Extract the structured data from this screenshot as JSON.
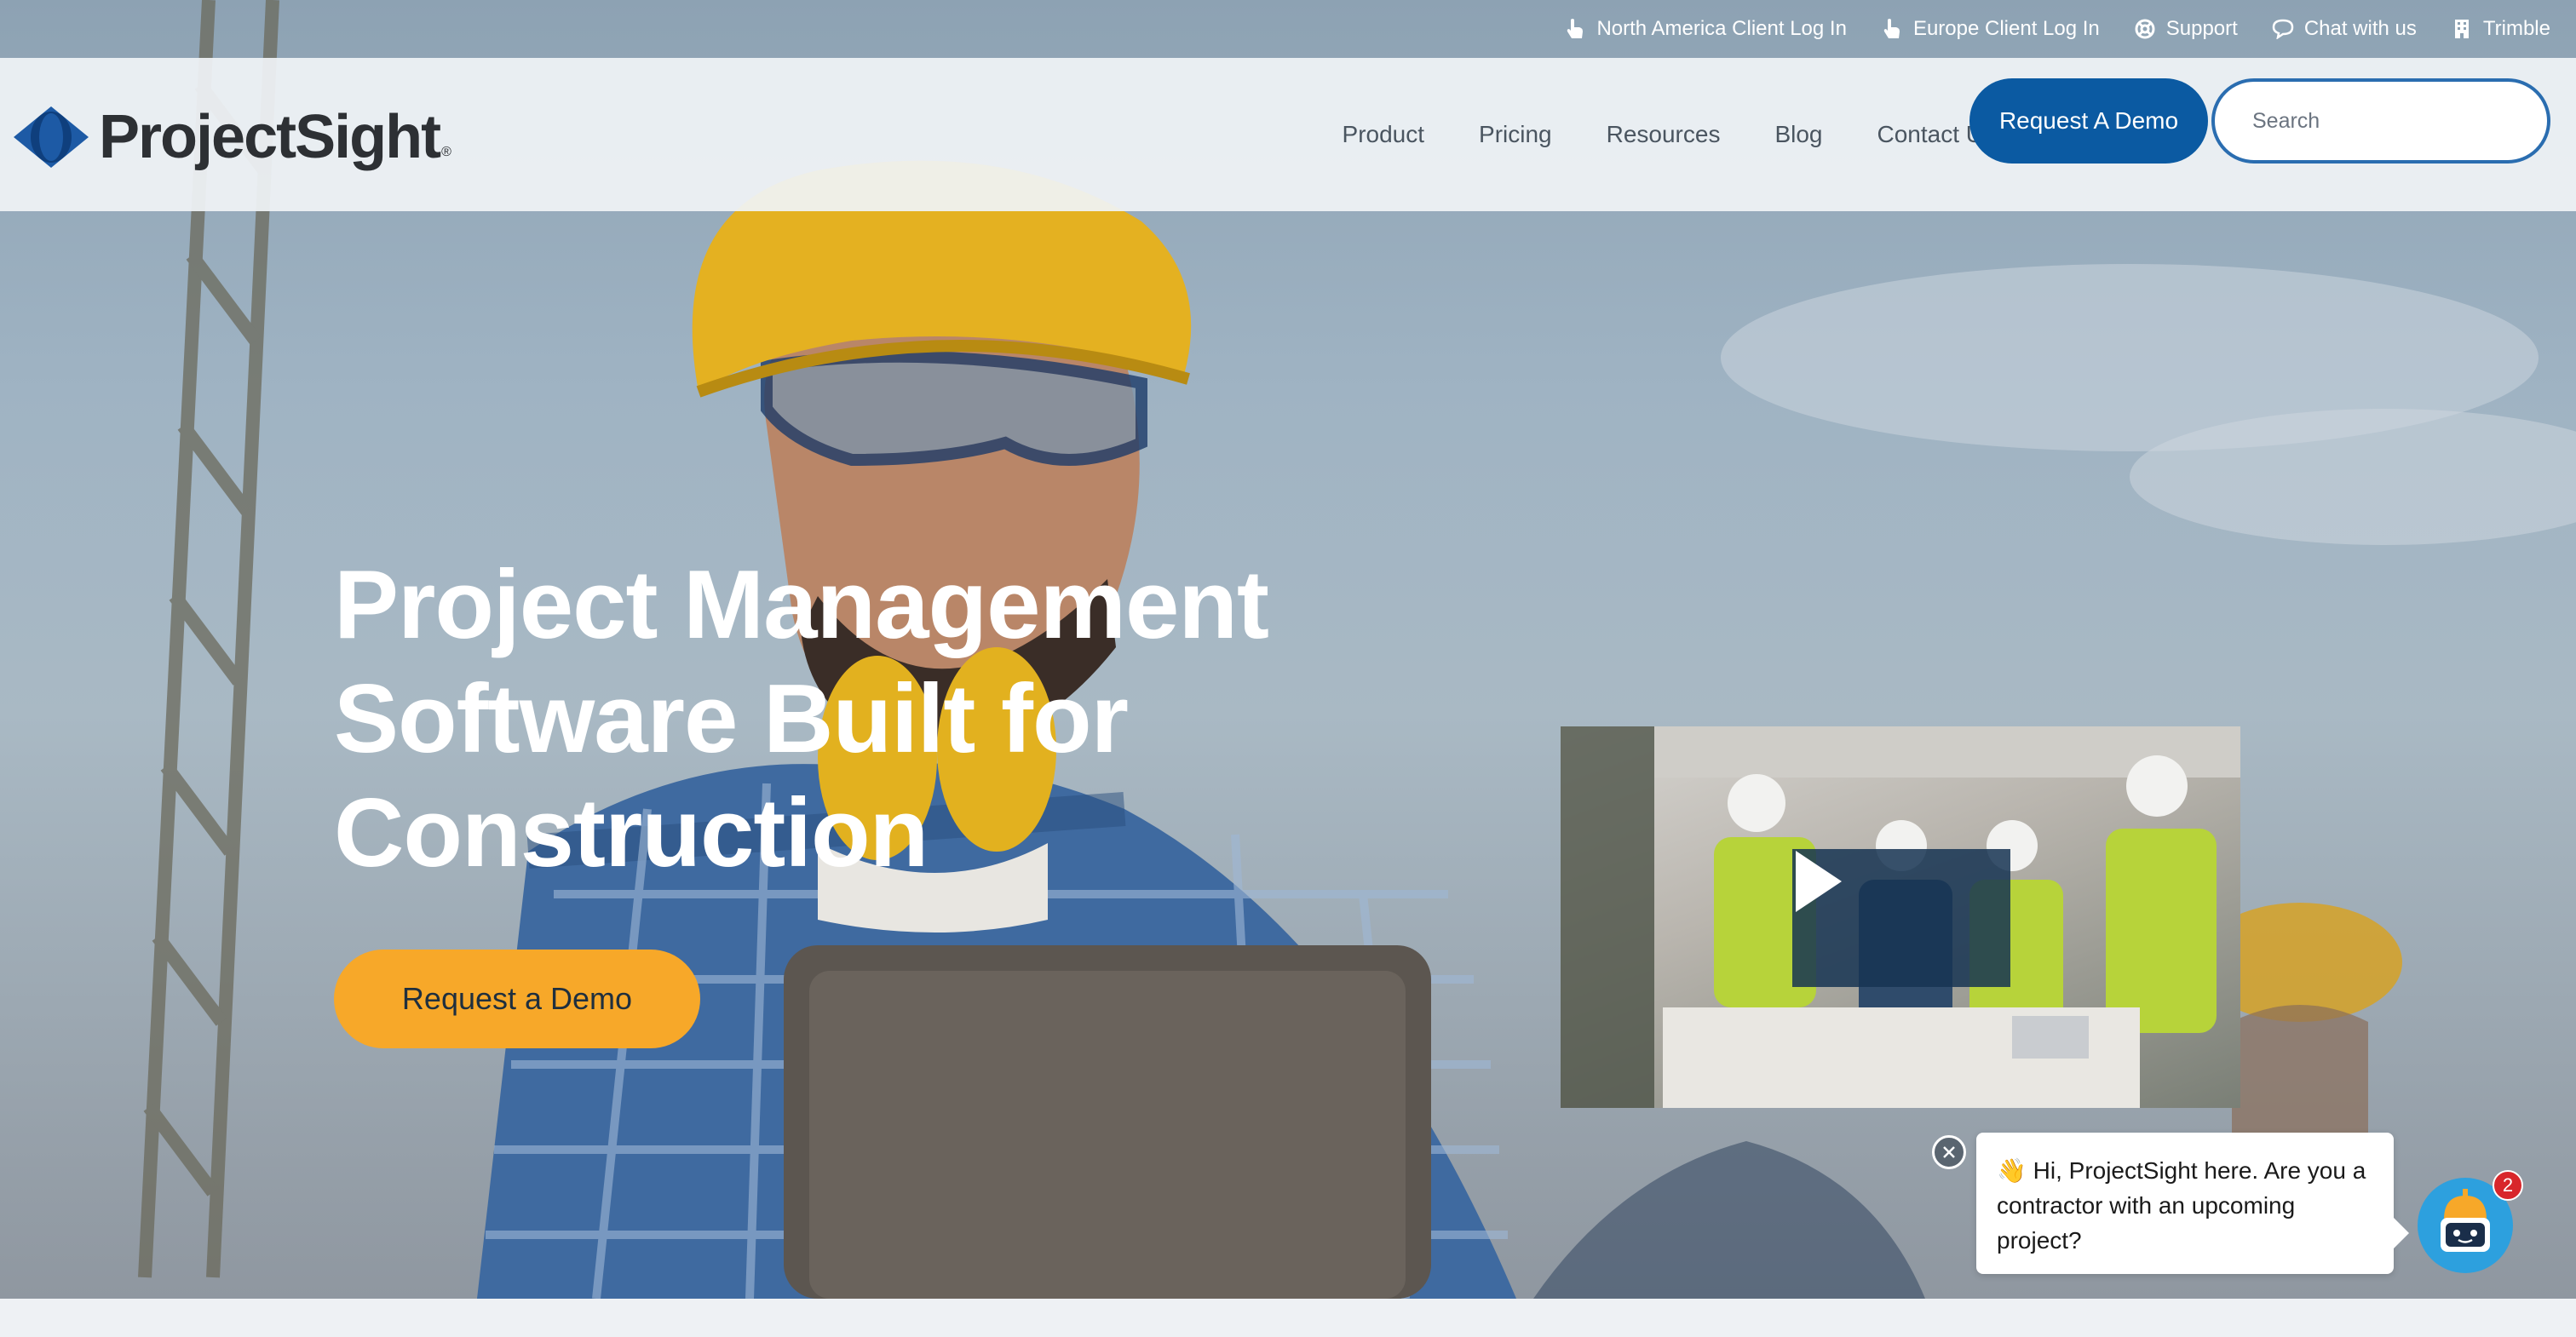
{
  "utility_bar": {
    "links": [
      {
        "label": "North America Client Log In",
        "icon": "pointer-hand-icon"
      },
      {
        "label": "Europe Client Log In",
        "icon": "pointer-hand-icon"
      },
      {
        "label": "Support",
        "icon": "life-ring-icon"
      },
      {
        "label": "Chat with us",
        "icon": "chat-bubble-icon"
      },
      {
        "label": "Trimble",
        "icon": "building-icon"
      }
    ]
  },
  "header": {
    "logo_text": "ProjectSight",
    "logo_mark": "®",
    "nav": [
      "Product",
      "Pricing",
      "Resources",
      "Blog",
      "Contact Us"
    ],
    "demo_button": "Request A Demo",
    "search_placeholder": "Search"
  },
  "hero": {
    "title_lines": [
      "Project Management",
      "Software Built for",
      "Construction"
    ],
    "cta": "Request a Demo"
  },
  "video": {
    "play_icon": "play-icon"
  },
  "chat": {
    "message": "👋 Hi, ProjectSight here. Are you a contractor with an upcoming project?",
    "badge_count": "2",
    "avatar_icon": "robot-icon"
  },
  "colors": {
    "brand_blue": "#0b5aa2",
    "cta_yellow": "#f7a829",
    "badge_red": "#d8262b",
    "chat_avatar": "#2da0de"
  }
}
